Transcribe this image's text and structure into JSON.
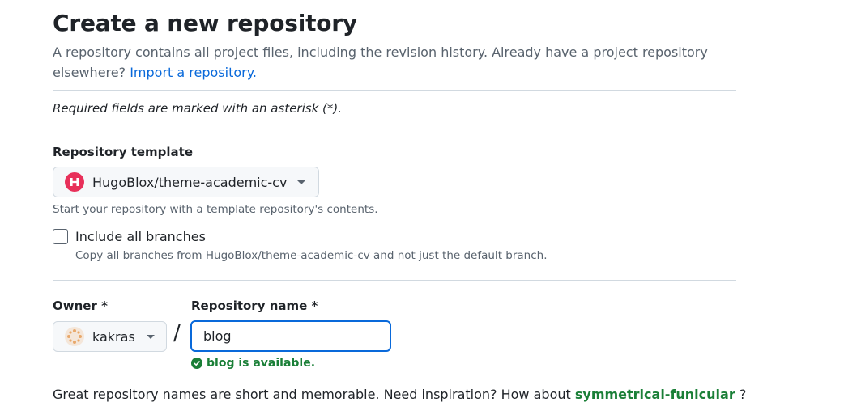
{
  "header": {
    "title": "Create a new repository",
    "description": "A repository contains all project files, including the revision history. Already have a project repository elsewhere?",
    "import_link": "Import a repository."
  },
  "required_note": "Required fields are marked with an asterisk (*).",
  "template": {
    "label": "Repository template",
    "selected": "HugoBlox/theme-academic-cv",
    "icon": "hugoblox-logo-icon",
    "hint": "Start your repository with a template repository's contents.",
    "include_branches_label": "Include all branches",
    "include_branches_checked": false,
    "include_branches_hint": "Copy all branches from HugoBlox/theme-academic-cv and not just the default branch."
  },
  "owner": {
    "label": "Owner *",
    "selected": "kakras",
    "icon": "avatar-icon"
  },
  "separator": "/",
  "repo_name": {
    "label": "Repository name *",
    "value": "blog",
    "availability": "blog is available."
  },
  "inspiration": {
    "text": "Great repository names are short and memorable. Need inspiration? How about",
    "suggestion": "symmetrical-funicular",
    "suffix": "?"
  },
  "colors": {
    "link": "#0969da",
    "success": "#1a7f37",
    "hugo_brand": "#e8305a",
    "border": "#d1d9e0"
  }
}
